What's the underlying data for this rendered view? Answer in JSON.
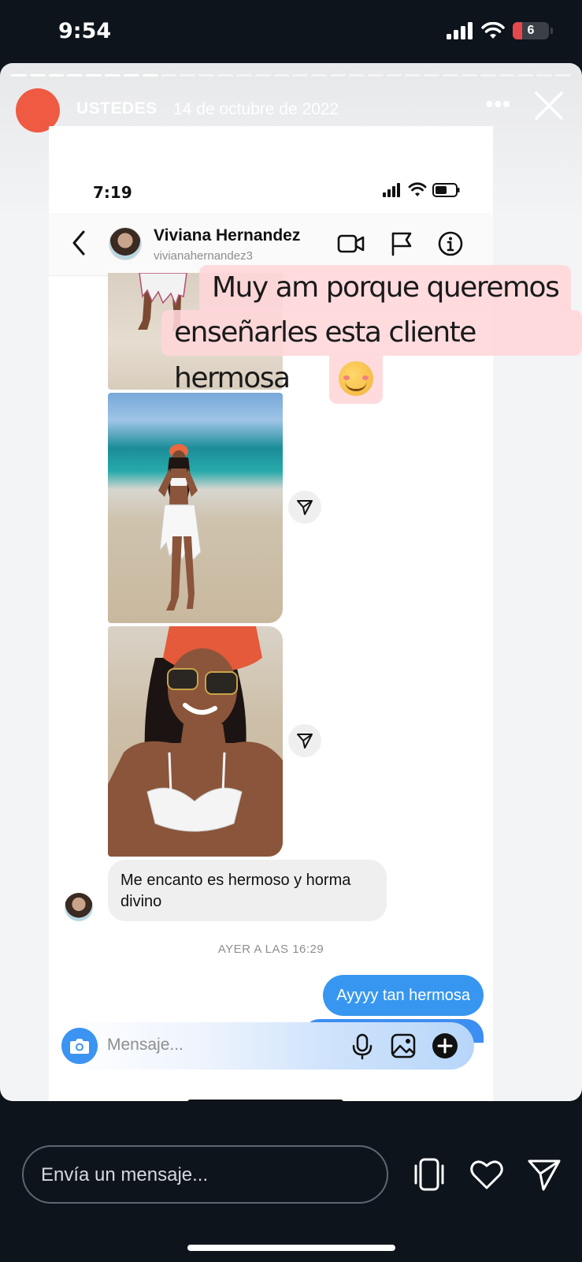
{
  "status_bar": {
    "time": "9:54",
    "battery": "6"
  },
  "story": {
    "username": "USTEDES",
    "date": "14 de octubre de 2022",
    "more_label": "•••",
    "progress_done": 8,
    "progress_total": 30
  },
  "screenshot": {
    "time": "7:19",
    "contact": {
      "name": "Viviana Hernandez",
      "handle": "vivianahernandez3"
    },
    "messages": {
      "received": "Me encanto es hermoso y horma divino",
      "timestamp": "AYER A LAS 16:29",
      "sent": "Ayyyy tan hermosa"
    },
    "composer_placeholder": "Mensaje..."
  },
  "overlay": {
    "line1": "Muy am porque queremos",
    "line2": "enseñarles esta cliente hermosa",
    "emoji_name": "smiling-face-with-hearts-emoji"
  },
  "bottom_bar": {
    "reply_placeholder": "Envía un mensaje..."
  },
  "colors": {
    "story_avatar": "#ef5a42",
    "sent_bubble": "#3797f0",
    "overlay_highlight": "#ffd6da"
  }
}
